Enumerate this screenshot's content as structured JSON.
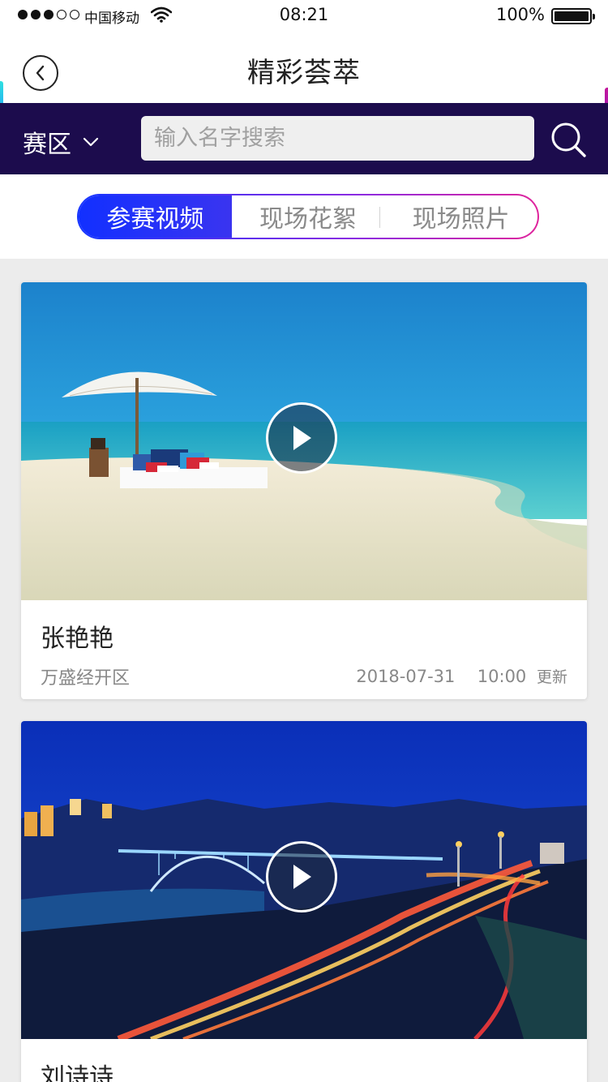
{
  "status_bar": {
    "carrier": "中国移动",
    "time": "08:21",
    "battery": "100%"
  },
  "header": {
    "title": "精彩荟萃"
  },
  "filter": {
    "region_label": "赛区",
    "search_placeholder": "输入名字搜索"
  },
  "tabs": [
    {
      "label": "参赛视频",
      "active": true
    },
    {
      "label": "现场花絮",
      "active": false
    },
    {
      "label": "现场照片",
      "active": false
    }
  ],
  "cards": [
    {
      "name": "张艳艳",
      "area": "万盛经开区",
      "date": "2018-07-31",
      "time": "10:00",
      "update_label": "更新"
    },
    {
      "name": "刘诗诗"
    }
  ],
  "colors": {
    "filter_bar_bg": "#1c0c4d",
    "tab_active": "#1230ff",
    "segment_border_end": "#e0249c"
  }
}
